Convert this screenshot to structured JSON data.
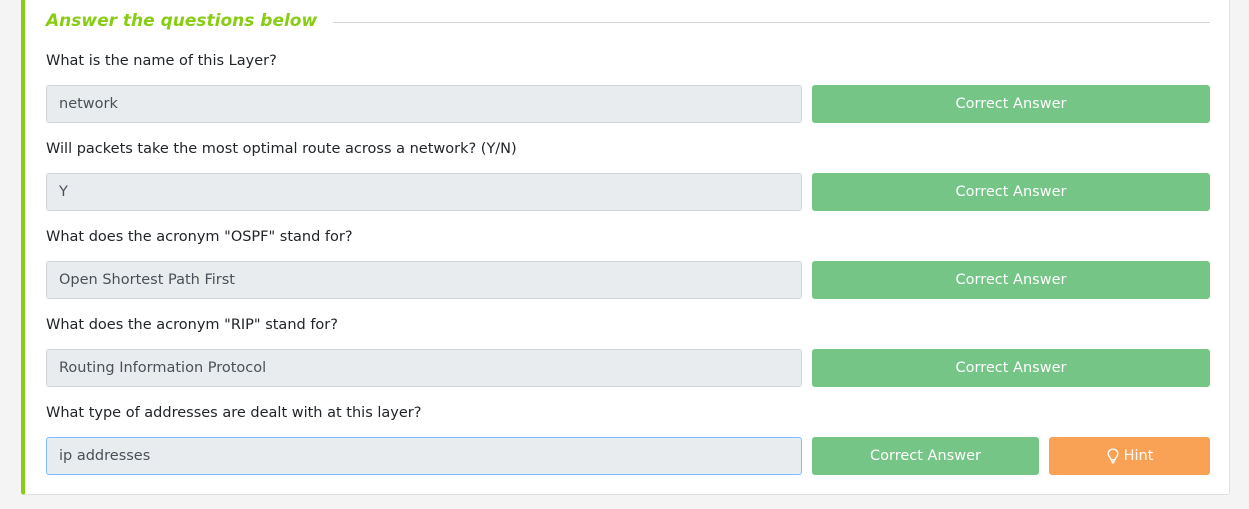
{
  "section": {
    "heading": "Answer the questions below"
  },
  "questions": [
    {
      "text": "What is the name of this Layer?",
      "answer": "network",
      "button_label": "Correct Answer"
    },
    {
      "text": "Will packets take the most optimal route across a network? (Y/N)",
      "answer": "Y",
      "button_label": "Correct Answer"
    },
    {
      "text": "What does the acronym \"OSPF\" stand for?",
      "answer": "Open Shortest Path First",
      "button_label": "Correct Answer"
    },
    {
      "text": "What does the acronym \"RIP\" stand for?",
      "answer": "Routing Information Protocol",
      "button_label": "Correct Answer"
    },
    {
      "text": "What type of addresses are dealt with at this layer?",
      "answer": "ip addresses",
      "button_label": "Correct Answer",
      "hint_label": "Hint",
      "hint_icon": "lightbulb-icon"
    }
  ],
  "colors": {
    "accent": "#88cc14",
    "correct": "#74c586",
    "hint": "#f9a155"
  }
}
